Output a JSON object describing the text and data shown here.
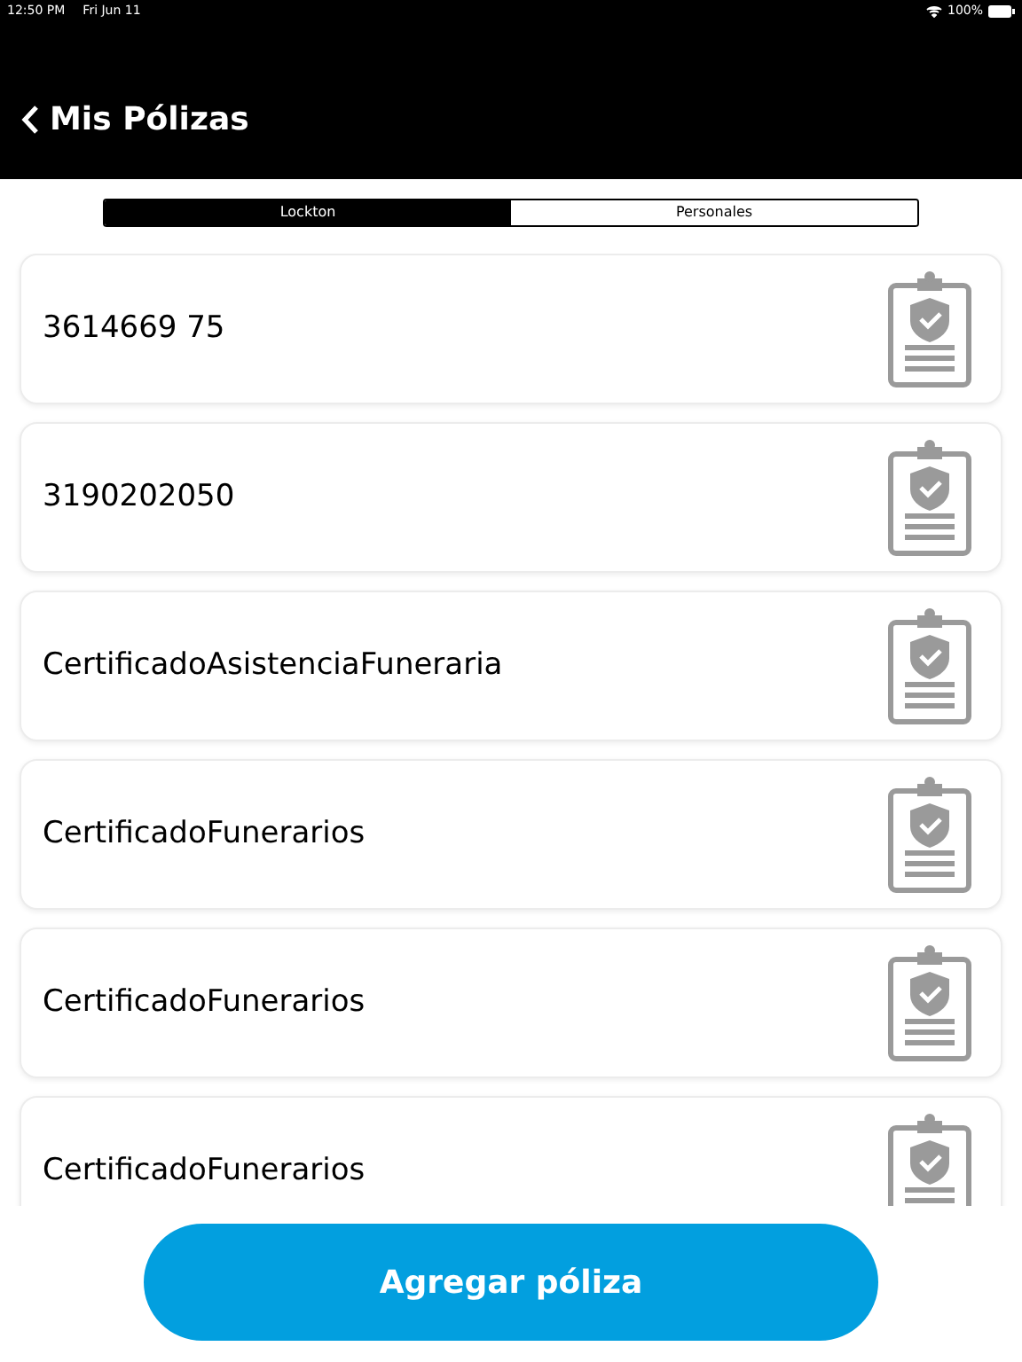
{
  "status_bar": {
    "time": "12:50 PM",
    "date": "Fri Jun 11",
    "battery": "100%"
  },
  "header": {
    "back_label": "Mis Pólizas"
  },
  "tabs": [
    {
      "label": "Lockton",
      "selected": true
    },
    {
      "label": "Personales",
      "selected": false
    }
  ],
  "policies": [
    {
      "name": "3614669 75"
    },
    {
      "name": "3190202050"
    },
    {
      "name": "CertificadoAsistenciaFuneraria"
    },
    {
      "name": "CertificadoFunerarios"
    },
    {
      "name": "CertificadoFunerarios"
    },
    {
      "name": "CertificadoFunerarios"
    }
  ],
  "add_button": "Agregar póliza"
}
